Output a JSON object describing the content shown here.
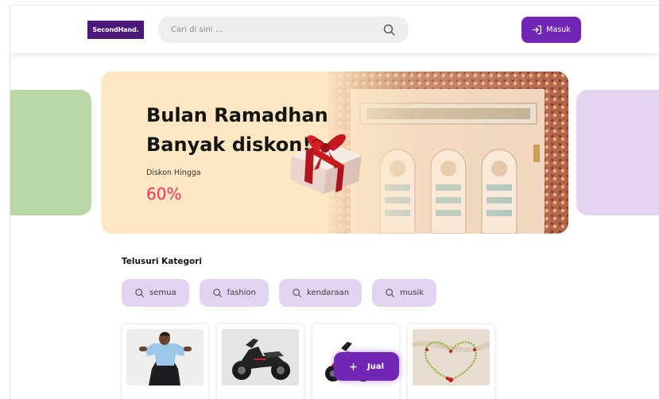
{
  "header": {
    "logo": "SecondHand.",
    "search_placeholder": "Cari di sini ...",
    "login_label": "Masuk"
  },
  "banner": {
    "title": "Bulan Ramadhan Banyak diskon!",
    "subtitle": "Diskon Hingga",
    "percent": "60%"
  },
  "categories": {
    "title": "Telusuri Kategori",
    "items": [
      {
        "label": "semua",
        "icon": "search-icon"
      },
      {
        "label": "fashion",
        "icon": "search-icon"
      },
      {
        "label": "kendaraan",
        "icon": "search-icon"
      },
      {
        "label": "musik",
        "icon": "search-icon"
      }
    ]
  },
  "products": [
    {
      "image": "woman-in-blue-shirt-photo"
    },
    {
      "image": "black-scooter-photo"
    },
    {
      "image": "red-scooter-photo"
    },
    {
      "image": "heart-bead-necklace-photo"
    }
  ],
  "fab": {
    "label": "Jual",
    "icon": "plus-icon"
  },
  "colors": {
    "primary": "#7126b5",
    "logo_bg": "#4b1979",
    "chip_bg": "#e2d4f0",
    "banner_bg": "#ffe7c4",
    "discount": "#fa2c5a"
  }
}
